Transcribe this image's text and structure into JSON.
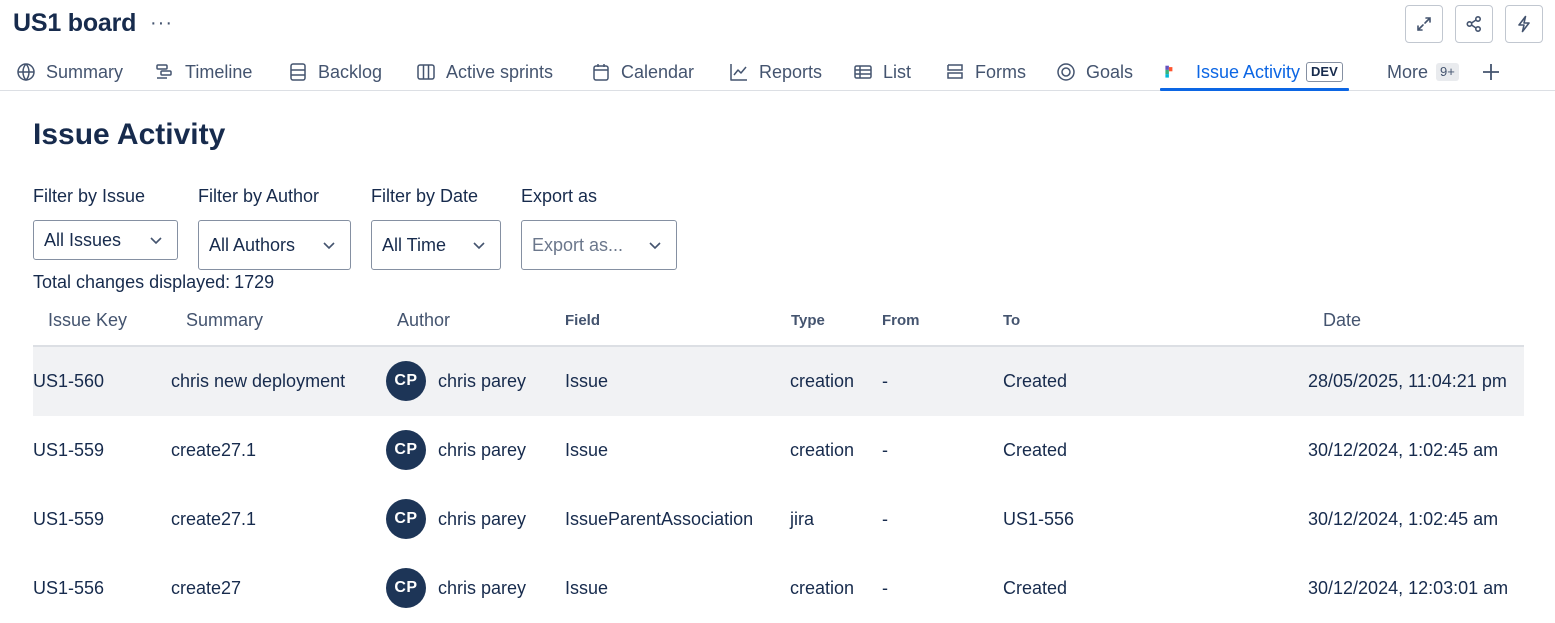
{
  "header": {
    "board_title": "US1 board",
    "more_label": "···",
    "buttons": [
      {
        "name": "expand",
        "icon": "expand-icon"
      },
      {
        "name": "share",
        "icon": "share-icon"
      },
      {
        "name": "automation",
        "icon": "lightning-icon"
      }
    ]
  },
  "tabs": [
    {
      "label": "Summary",
      "icon": "globe-icon"
    },
    {
      "label": "Timeline",
      "icon": "timeline-icon"
    },
    {
      "label": "Backlog",
      "icon": "backlog-icon"
    },
    {
      "label": "Active sprints",
      "icon": "board-columns-icon"
    },
    {
      "label": "Calendar",
      "icon": "calendar-icon"
    },
    {
      "label": "Reports",
      "icon": "chart-line-icon"
    },
    {
      "label": "List",
      "icon": "list-table-icon"
    },
    {
      "label": "Forms",
      "icon": "forms-icon"
    },
    {
      "label": "Goals",
      "icon": "goal-icon"
    },
    {
      "label": "Issue Activity",
      "icon": "app-logo-icon",
      "active": true,
      "badge": "DEV"
    },
    {
      "label": "More",
      "count": "9+"
    }
  ],
  "accent_color": "#0c66e4",
  "page": {
    "title": "Issue Activity",
    "filters": [
      {
        "label": "Filter by Issue",
        "value": "All Issues"
      },
      {
        "label": "Filter by Author",
        "value": "All Authors"
      },
      {
        "label": "Filter by Date",
        "value": "All Time"
      },
      {
        "label": "Export as",
        "placeholder": "Export as..."
      }
    ],
    "total_label": "Total changes displayed:",
    "total_value": "1729"
  },
  "table": {
    "columns": [
      "Issue Key",
      "Summary",
      "Author",
      "Field",
      "Type",
      "From",
      "To",
      "Date"
    ],
    "rows": [
      {
        "key": "US1-560",
        "summary": "chris new deployment",
        "initials": "CP",
        "author": "chris parey",
        "field": "Issue",
        "type": "creation",
        "from": "-",
        "to": "Created",
        "date": "28/05/2025, 11:04:21 pm"
      },
      {
        "key": "US1-559",
        "summary": "create27.1",
        "initials": "CP",
        "author": "chris parey",
        "field": "Issue",
        "type": "creation",
        "from": "-",
        "to": "Created",
        "date": "30/12/2024, 1:02:45 am"
      },
      {
        "key": "US1-559",
        "summary": "create27.1",
        "initials": "CP",
        "author": "chris parey",
        "field": "IssueParentAssociation",
        "type": "jira",
        "from": "-",
        "to": "US1-556",
        "date": "30/12/2024, 1:02:45 am"
      },
      {
        "key": "US1-556",
        "summary": "create27",
        "initials": "CP",
        "author": "chris parey",
        "field": "Issue",
        "type": "creation",
        "from": "-",
        "to": "Created",
        "date": "30/12/2024, 12:03:01 am"
      }
    ]
  }
}
